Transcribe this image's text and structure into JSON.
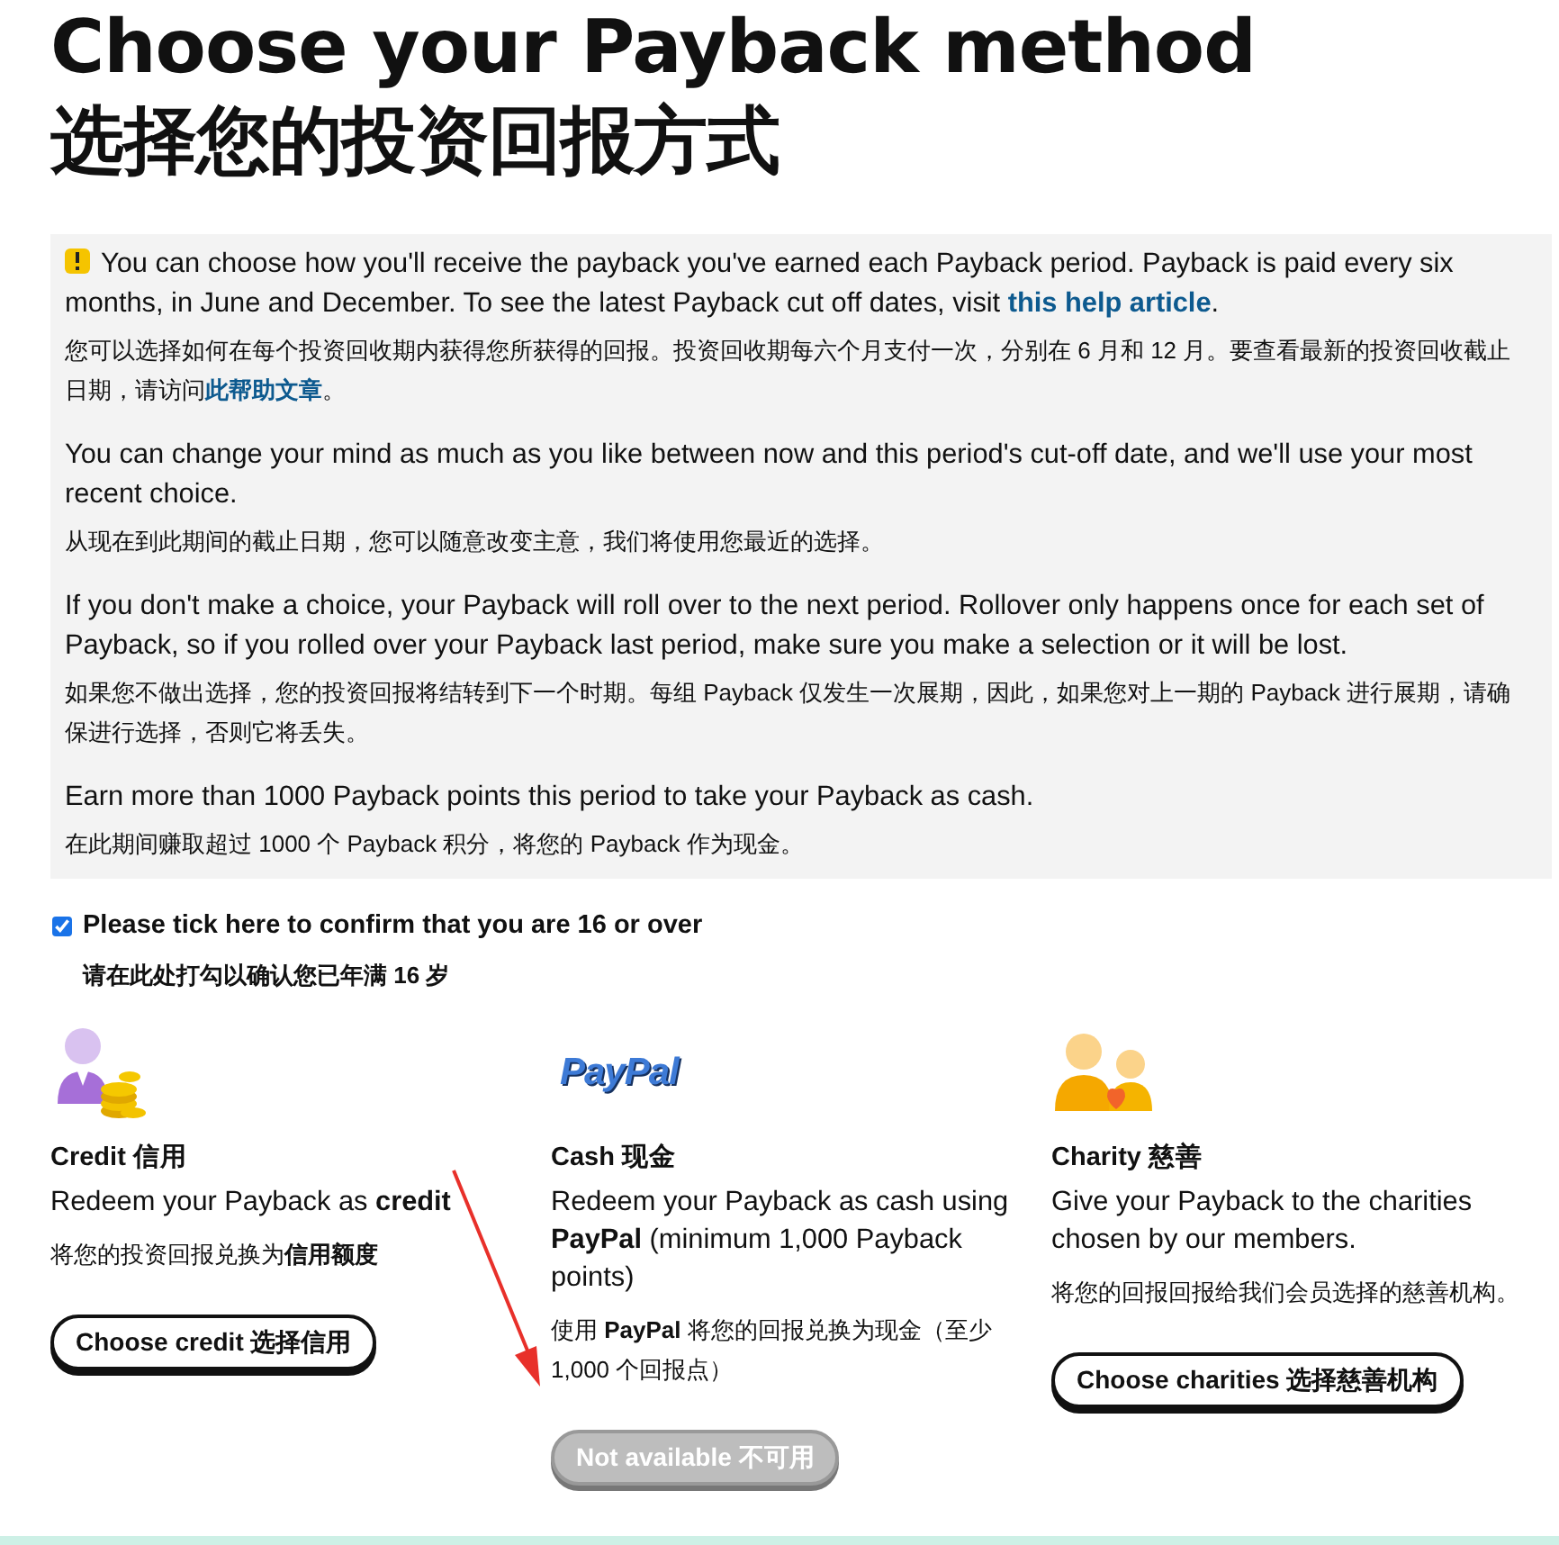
{
  "title_lines": [
    "Choose your Payback method",
    "选择您的投资回报方式"
  ],
  "notice": {
    "warning": true,
    "paragraphs": [
      {
        "kind": "en",
        "text": "You can choose how you'll receive the payback you've earned each Payback period. Payback is paid every six months, in June and December. To see the latest Payback cut off dates, visit ",
        "link": "this help article",
        "after": "."
      },
      {
        "kind": "zh",
        "text": "您可以选择如何在每个投资回收期内获得您所获得的回报。投资回收期每六个月支付一次，分别在 6 月和 12 月。要查看最新的投资回收截止日期，请访问",
        "link": "此帮助文章",
        "after": "。"
      },
      {
        "kind": "en",
        "text": "You can change your mind as much as you like between now and this period's cut-off date, and we'll use your most recent choice."
      },
      {
        "kind": "zh",
        "text": "从现在到此期间的截止日期，您可以随意改变主意，我们将使用您最近的选择。"
      },
      {
        "kind": "en",
        "text": "If you don't make a choice, your Payback will roll over to the next period. Rollover only happens once for each set of Payback, so if you rolled over your Payback last period, make sure you make a selection or it will be lost."
      },
      {
        "kind": "zh",
        "text": "如果您不做出选择，您的投资回报将结转到下一个时期。每组 Payback 仅发生一次展期，因此，如果您对上一期的 Payback 进行展期，请确保进行选择，否则它将丢失。"
      },
      {
        "kind": "en",
        "text": "Earn more than 1000 Payback points this period to take your Payback as cash."
      },
      {
        "kind": "zh",
        "text": "在此期间赚取超过 1000 个 Payback 积分，将您的 Payback 作为现金。"
      }
    ]
  },
  "confirm": {
    "checked": true,
    "label": "Please tick here to confirm that you are 16 or over",
    "label_zh": "请在此处打勾以确认您已年满 16 岁"
  },
  "options": [
    {
      "kind": "credit",
      "title": "Credit 信用",
      "description": "Redeem your Payback as **credit**",
      "description_zh": "将您的投资回报兑换为**信用额度**",
      "button": "Choose credit 选择信用",
      "disabled": false
    },
    {
      "kind": "paypal",
      "logo_text": "PayPal",
      "title": "Cash 现金",
      "description": "Redeem your Payback as cash using **PayPal** (minimum 1,000 Payback points)",
      "description_zh": "使用 **PayPal** 将您的回报兑换为现金（至少 1,000 个回报点）",
      "button": "Not available 不可用",
      "disabled": true
    },
    {
      "kind": "charity",
      "title": "Charity 慈善",
      "description": "Give your Payback to the charities chosen by our members.",
      "description_zh": "将您的回报回报给我们会员选择的慈善机构。",
      "button": "Choose charities 选择慈善机构",
      "disabled": false
    }
  ],
  "annotation": {
    "kind": "arrow"
  }
}
